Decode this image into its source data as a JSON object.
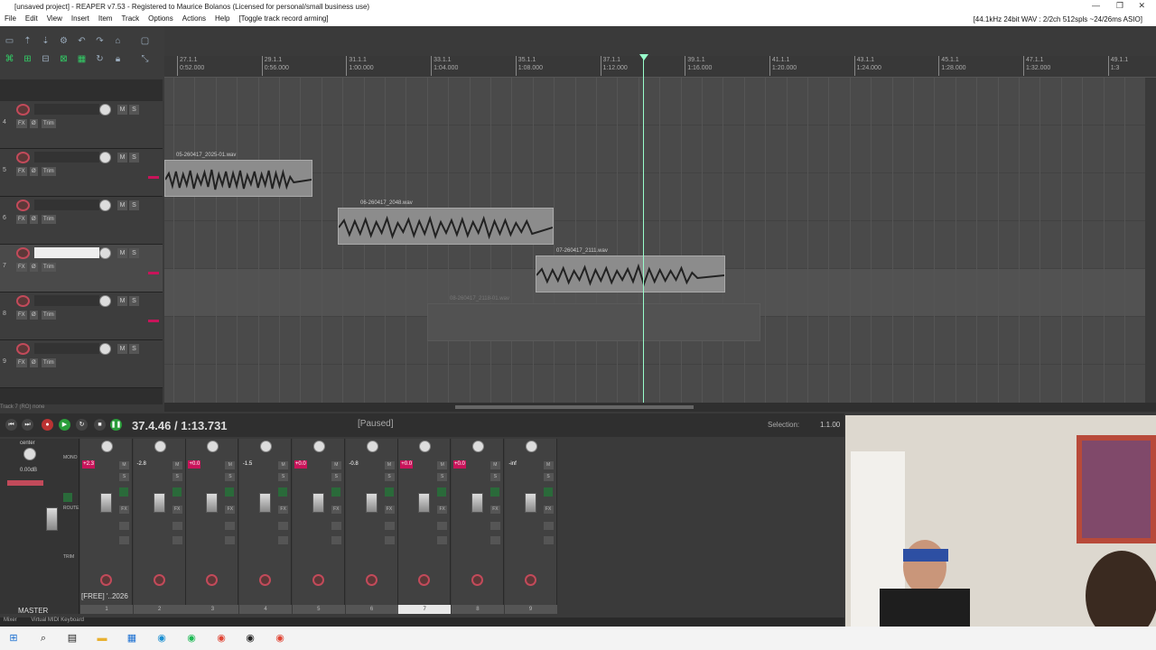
{
  "window": {
    "title": "[unsaved project] - REAPER v7.53 - Registered to Maurice Bolanos (Licensed for personal/small business use)"
  },
  "menu": {
    "items": [
      "File",
      "Edit",
      "View",
      "Insert",
      "Item",
      "Track",
      "Options",
      "Actions",
      "Help",
      "[Toggle track record arming]"
    ],
    "format": "[44.1kHz 24bit WAV : 2/2ch 512spls ~24/26ms ASIO]"
  },
  "ruler": {
    "ticks": [
      {
        "bar": "27.1.1",
        "time": "0:52.000"
      },
      {
        "bar": "29.1.1",
        "time": "0:56.000"
      },
      {
        "bar": "31.1.1",
        "time": "1:00.000"
      },
      {
        "bar": "33.1.1",
        "time": "1:04.000"
      },
      {
        "bar": "35.1.1",
        "time": "1:08.000"
      },
      {
        "bar": "37.1.1",
        "time": "1:12.000"
      },
      {
        "bar": "39.1.1",
        "time": "1:16.000"
      },
      {
        "bar": "41.1.1",
        "time": "1:20.000"
      },
      {
        "bar": "43.1.1",
        "time": "1:24.000"
      },
      {
        "bar": "45.1.1",
        "time": "1:28.000"
      },
      {
        "bar": "47.1.1",
        "time": "1:32.000"
      },
      {
        "bar": "49.1.1",
        "time": "1:3"
      }
    ]
  },
  "tracks": [
    {
      "num": "4",
      "fx": "FX",
      "trim": "Trim"
    },
    {
      "num": "5",
      "fx": "FX",
      "trim": "Trim"
    },
    {
      "num": "6",
      "fx": "FX",
      "trim": "Trim"
    },
    {
      "num": "7",
      "fx": "FX",
      "trim": "Trim"
    },
    {
      "num": "8",
      "fx": "FX",
      "trim": "Trim"
    },
    {
      "num": "9",
      "fx": "FX",
      "trim": "Trim"
    }
  ],
  "items": [
    {
      "label": "05-260417_2025-01.wav"
    },
    {
      "label": "06-260417_2048.wav"
    },
    {
      "label": "07-260417_2111.wav"
    },
    {
      "label": "08-260417_2118-01.wav"
    }
  ],
  "status": {
    "trackhint": "Track 7 (RO) none"
  },
  "transport": {
    "time": "37.4.46 / 1:13.731",
    "state": "[Paused]",
    "selection_label": "Selection:",
    "selection_value": "1.1.00"
  },
  "master": {
    "pan": "center",
    "db": "0.00dB",
    "label": "MASTER",
    "mono": "MONO",
    "route": "ROUTE",
    "trim": "TRIM"
  },
  "mixer": {
    "strips": [
      {
        "num": "1",
        "peak": "+2.3",
        "peak_red": true,
        "mute": "M",
        "solo": "S"
      },
      {
        "num": "2",
        "peak": "-2.8",
        "peak_red": false,
        "mute": "M",
        "solo": "S"
      },
      {
        "num": "3",
        "peak": "+0.0",
        "peak_red": true,
        "mute": "M",
        "solo": "S"
      },
      {
        "num": "4",
        "peak": "-1.5",
        "peak_red": false,
        "mute": "M",
        "solo": "S"
      },
      {
        "num": "5",
        "peak": "+0.0",
        "peak_red": true,
        "mute": "M",
        "solo": "S"
      },
      {
        "num": "6",
        "peak": "-0.8",
        "peak_red": false,
        "mute": "M",
        "solo": "S"
      },
      {
        "num": "7",
        "peak": "+0.0",
        "peak_red": true,
        "mute": "M",
        "solo": "S"
      },
      {
        "num": "8",
        "peak": "+0.0",
        "peak_red": true,
        "mute": "M",
        "solo": "S"
      },
      {
        "num": "9",
        "peak": "-inf",
        "peak_red": false,
        "mute": "M",
        "solo": "S"
      }
    ],
    "project_label": "[FREE] '..2026",
    "tabs": [
      "Mixer",
      "Virtual MIDI Keyboard"
    ]
  },
  "colors": {
    "accent": "#c24a5a",
    "cursor": "#99ffcc",
    "item": "#8c8c8c"
  }
}
